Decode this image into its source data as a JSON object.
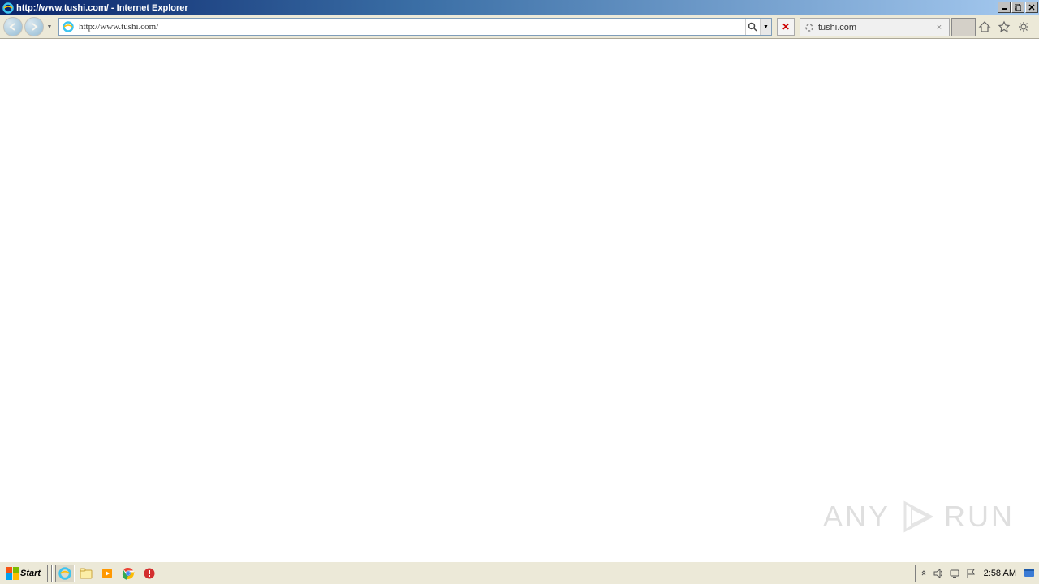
{
  "window": {
    "title": "http://www.tushi.com/ - Internet Explorer"
  },
  "address": {
    "url": "http://www.tushi.com/"
  },
  "tab": {
    "label": "tushi.com"
  },
  "taskbar": {
    "start_label": "Start",
    "clock": "2:58 AM"
  },
  "watermark": {
    "left": "ANY",
    "right": "RUN"
  }
}
